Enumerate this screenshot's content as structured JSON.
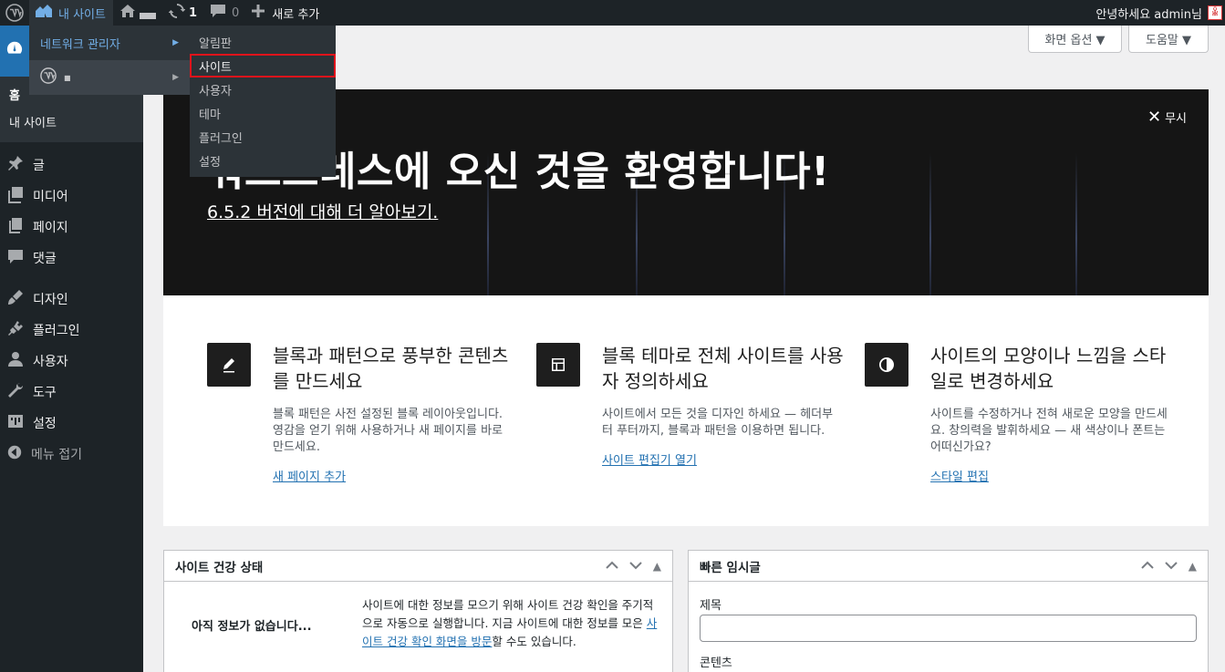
{
  "admin_bar": {
    "my_sites": "내 사이트",
    "updates_count": "1",
    "comments_count": "0",
    "new_content": "새로 추가",
    "greeting": "안녕하세요 admin님",
    "avatar_text": "ꊎ"
  },
  "my_sites_menu": {
    "network_admin": "네트워크 관리자",
    "site_name": "■"
  },
  "network_admin_submenu": [
    "알림판",
    "사이트",
    "사용자",
    "테마",
    "플러그인",
    "설정"
  ],
  "sidebar": {
    "dashboard_sub": [
      "홈",
      "내 사이트"
    ],
    "items": [
      {
        "label": "글",
        "icon": "pin-icon"
      },
      {
        "label": "미디어",
        "icon": "media-icon"
      },
      {
        "label": "페이지",
        "icon": "pages-icon"
      },
      {
        "label": "댓글",
        "icon": "comments-icon"
      },
      {
        "label": "디자인",
        "icon": "appearance-icon"
      },
      {
        "label": "플러그인",
        "icon": "plugins-icon"
      },
      {
        "label": "사용자",
        "icon": "users-icon"
      },
      {
        "label": "도구",
        "icon": "tools-icon"
      },
      {
        "label": "설정",
        "icon": "settings-icon"
      },
      {
        "label": "메뉴 접기",
        "icon": "collapse-icon"
      }
    ]
  },
  "screen_options": "화면 옵션 ▼",
  "help": "도움말 ▼",
  "welcome": {
    "title": "워드프레스에 오신 것을 환영합니다!",
    "version_link": "6.5.2 버전에 대해 더 알아보기.",
    "dismiss": "무시",
    "columns": [
      {
        "title": "블록과 패턴으로 풍부한 콘텐츠를 만드세요",
        "text": "블록 패턴은 사전 설정된 블록 레이아웃입니다. 영감을 얻기 위해 사용하거나 새 페이지를 바로 만드세요.",
        "link": "새 페이지 추가",
        "icon": "edit-icon"
      },
      {
        "title": "블록 테마로 전체 사이트를 사용자 정의하세요",
        "text": "사이트에서 모든 것을 디자인 하세요 — 헤더부터 푸터까지, 블록과 패턴을 이용하면 됩니다.",
        "link": "사이트 편집기 열기",
        "icon": "layout-icon"
      },
      {
        "title": "사이트의 모양이나 느낌을 스타일로 변경하세요",
        "text": "사이트를 수정하거나 전혀 새로운 모양을 만드세요. 창의력을 발휘하세요 — 새 색상이나 폰트는 어떠신가요?",
        "link": "스타일 편집",
        "icon": "styles-icon"
      }
    ]
  },
  "site_health": {
    "title": "사이트 건강 상태",
    "no_info": "아직 정보가 없습니다...",
    "desc_before": "사이트에 대한 정보를 모으기 위해 사이트 건강 확인을 주기적으로 자동으로 실행합니다. 지금 사이트에 대한 정보를 모은 ",
    "desc_link": "사이트 건강 확인 화면을 방문",
    "desc_after": "할 수도 있습니다."
  },
  "quick_draft": {
    "title": "빠른 임시글",
    "title_label": "제목",
    "content_label": "콘텐츠"
  }
}
